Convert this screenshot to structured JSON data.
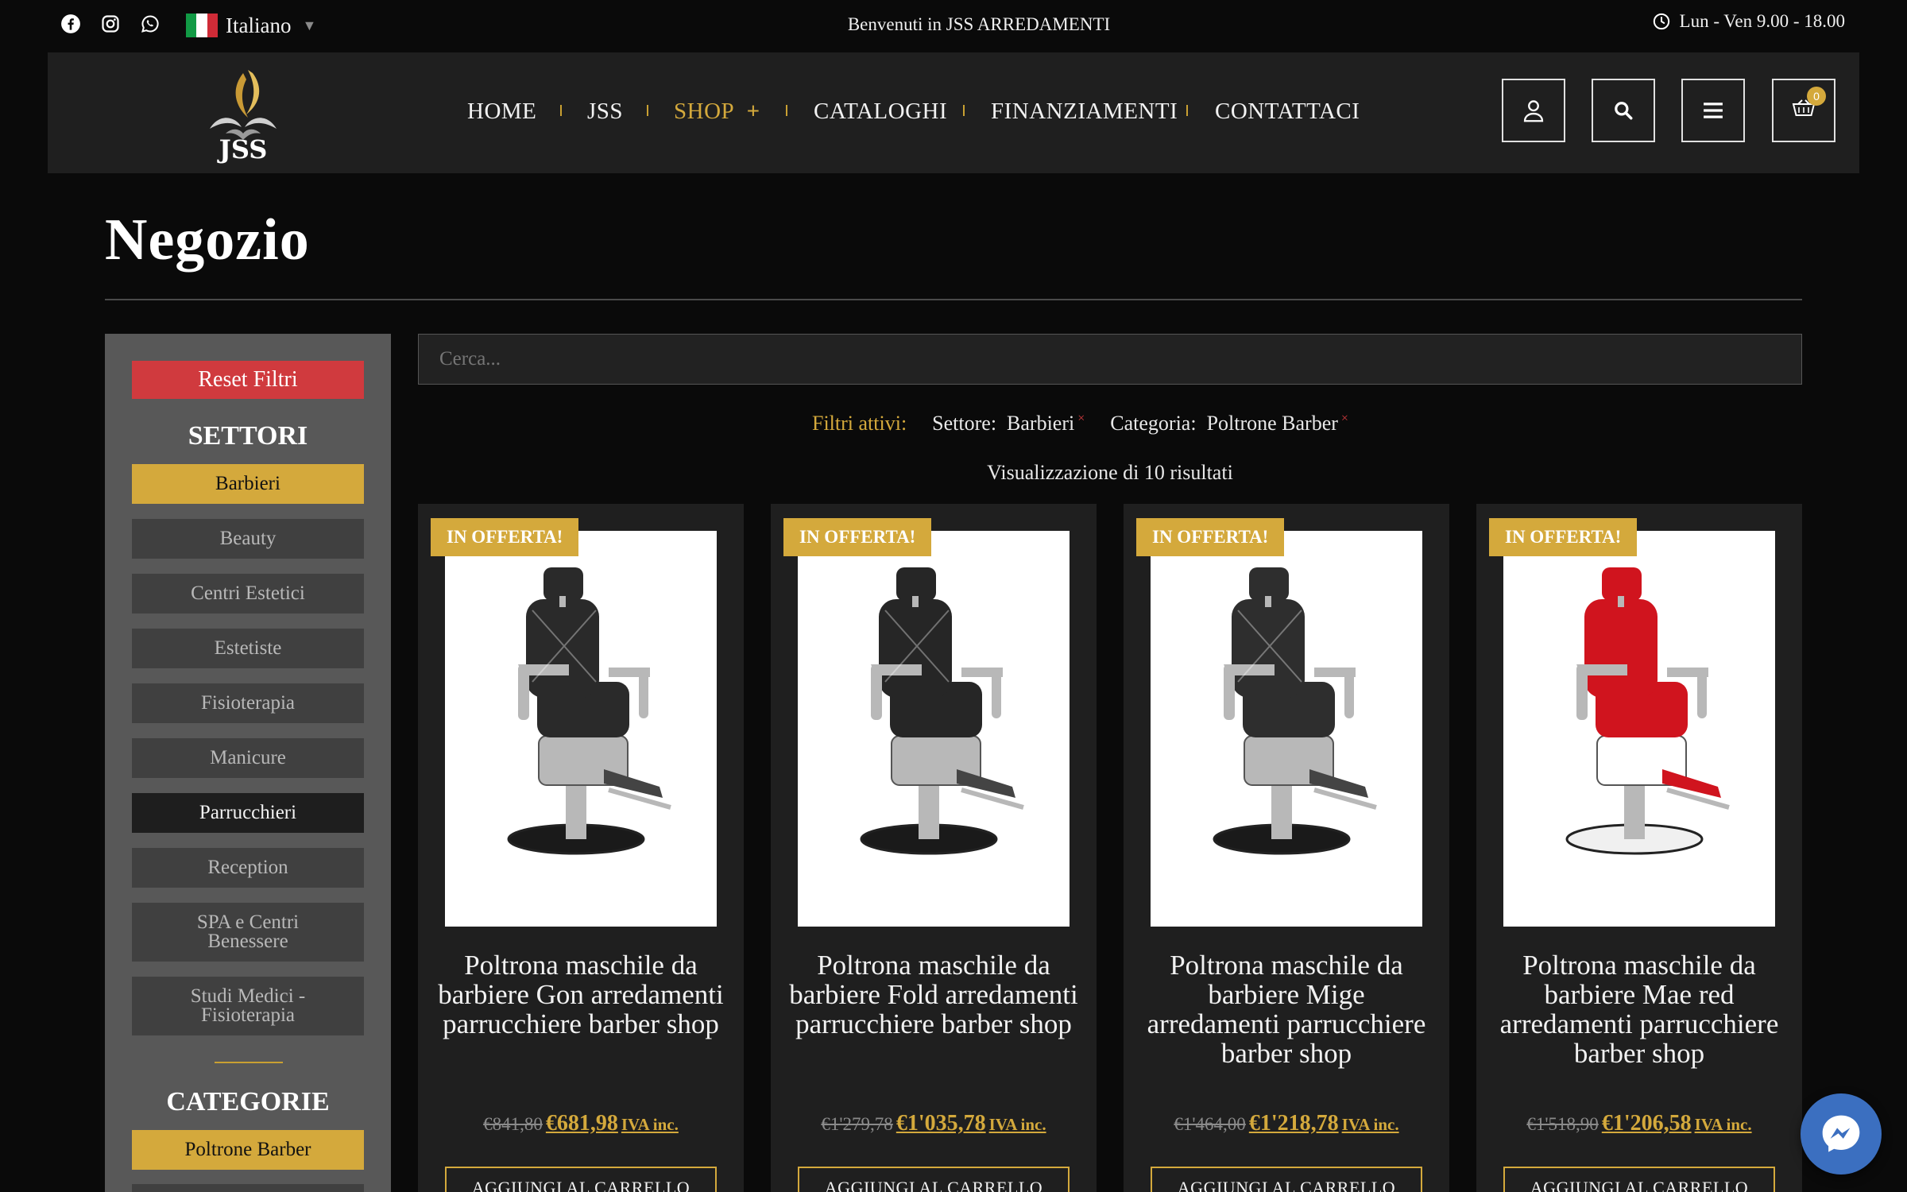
{
  "topbar": {
    "social_icons": [
      "facebook-icon",
      "instagram-icon",
      "whatsapp-icon"
    ],
    "language": "Italiano",
    "welcome": "Benvenuti in JSS ARREDAMENTI",
    "hours": "Lun - Ven 9.00 - 18.00"
  },
  "header": {
    "logo_text": "JSS",
    "nav": [
      {
        "label": "HOME"
      },
      {
        "label": "JSS"
      },
      {
        "label": "SHOP",
        "plus": "+"
      },
      {
        "label": "CATALOGHI"
      },
      {
        "label": "FINANZIAMENTI"
      },
      {
        "label": "CONTATTACI"
      }
    ],
    "cart_count": "0",
    "icons": [
      "user-icon",
      "search-icon",
      "menu-icon",
      "cart-icon"
    ]
  },
  "page": {
    "title": "Negozio"
  },
  "sidebar": {
    "reset_label": "Reset Filtri",
    "sectors_heading": "SETTORI",
    "sectors": [
      {
        "label": "Barbieri"
      },
      {
        "label": "Beauty"
      },
      {
        "label": "Centri Estetici"
      },
      {
        "label": "Estetiste"
      },
      {
        "label": "Fisioterapia"
      },
      {
        "label": "Manicure"
      },
      {
        "label": "Parrucchieri"
      },
      {
        "label": "Reception"
      },
      {
        "label": "SPA e Centri Benessere"
      },
      {
        "label": "Studi Medici - Fisioterapia"
      }
    ],
    "categories_heading": "CATEGORIE",
    "categories": [
      {
        "label": "Poltrone Barber"
      }
    ]
  },
  "main": {
    "search_placeholder": "Cerca...",
    "active_filters_label": "Filtri attivi:",
    "filter_1_key": "Settore:",
    "filter_1_value": "Barbieri",
    "filter_2_key": "Categoria:",
    "filter_2_value": "Poltrone Barber",
    "remove_mark": "×",
    "results_text": "Visualizzazione di 10 risultati",
    "products": [
      {
        "badge": "IN OFFERTA!",
        "name": "Poltrona maschile da barbiere Gon arredamenti parrucchiere barber shop",
        "old_price": "€841,80",
        "new_price": "€681,98",
        "tax": "IVA inc.",
        "button": "AGGIUNGI AL CARRELLO",
        "seat_color": "#2a2a2a"
      },
      {
        "badge": "IN OFFERTA!",
        "name": "Poltrona maschile da barbiere Fold arredamenti parrucchiere barber shop",
        "old_price": "€1'279,78",
        "new_price": "€1'035,78",
        "tax": "IVA inc.",
        "button": "AGGIUNGI AL CARRELLO",
        "seat_color": "#262626"
      },
      {
        "badge": "IN OFFERTA!",
        "name": "Poltrona maschile da barbiere Mige arredamenti parrucchiere barber shop",
        "old_price": "€1'464,00",
        "new_price": "€1'218,78",
        "tax": "IVA inc.",
        "button": "AGGIUNGI AL CARRELLO",
        "seat_color": "#2e2e2e"
      },
      {
        "badge": "IN OFFERTA!",
        "name": "Poltrona maschile da barbiere Mae red arredamenti parrucchiere barber shop",
        "old_price": "€1'518,90",
        "new_price": "€1'206,58",
        "tax": "IVA inc.",
        "button": "AGGIUNGI AL CARRELLO",
        "seat_color": "#d0141e"
      }
    ]
  },
  "colors": {
    "accent_gold": "#d4a93c",
    "reset_red": "#d03a3e",
    "messenger_blue": "#3b6fc0"
  }
}
